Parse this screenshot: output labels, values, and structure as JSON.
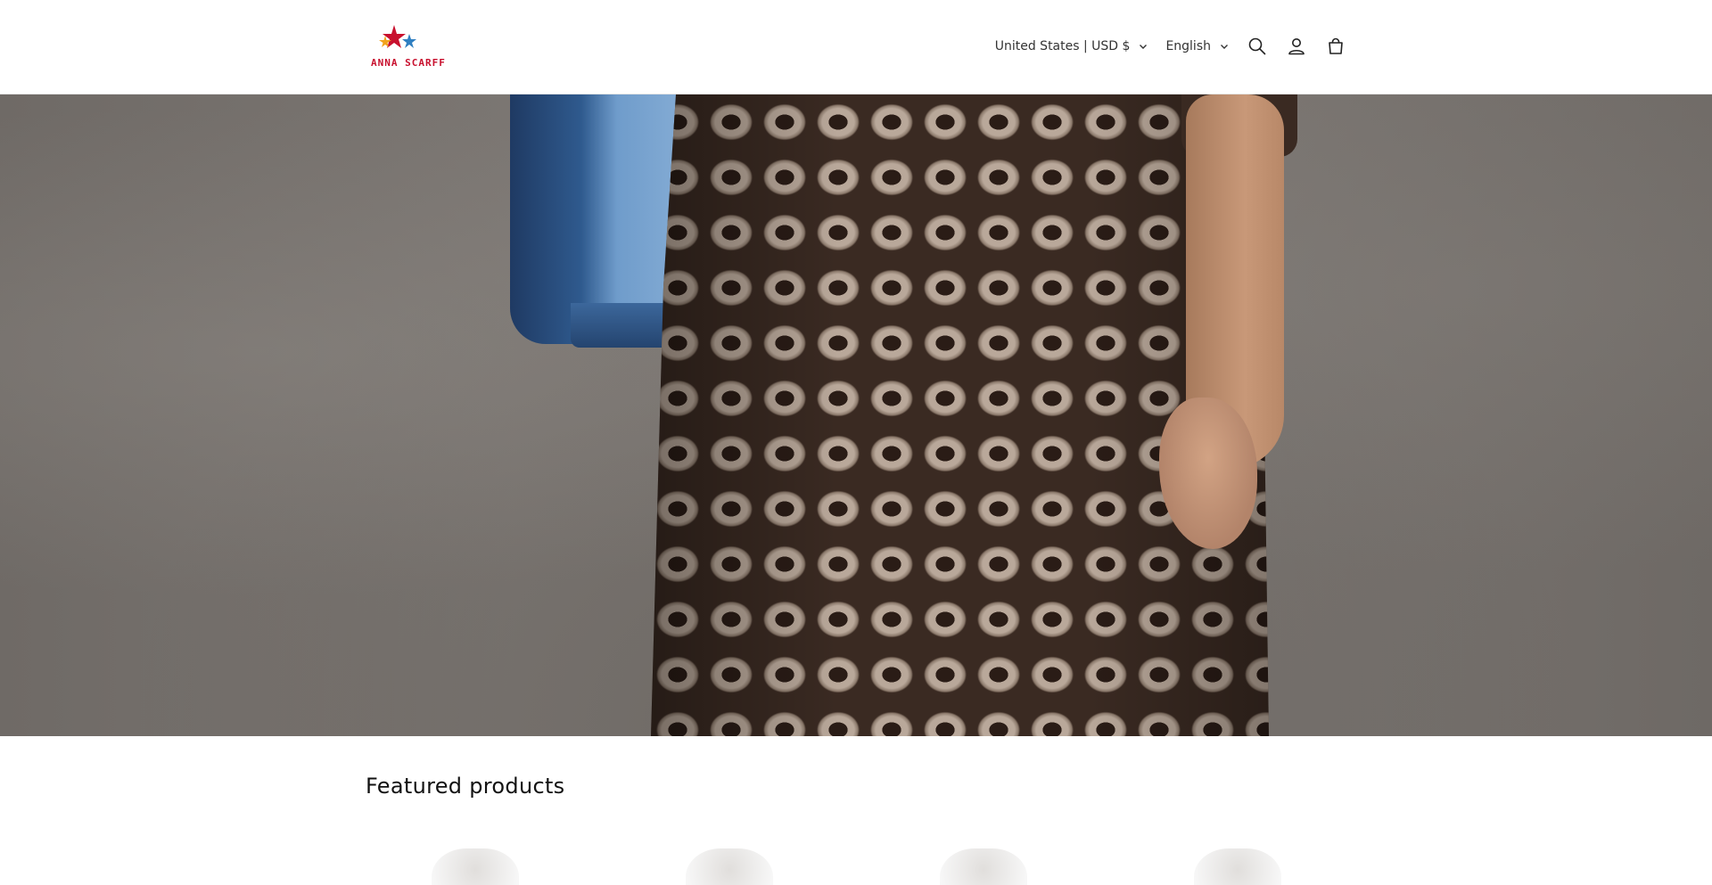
{
  "header": {
    "logo_text": "ANNA SCARFF",
    "localization": {
      "country_label": "United States | USD $",
      "language_label": "English"
    },
    "icons": [
      "search-icon",
      "account-icon",
      "cart-icon"
    ]
  },
  "hero": {
    "image_alt": ""
  },
  "featured": {
    "title": "Featured products",
    "products": [
      {
        "name": ""
      },
      {
        "name": ""
      },
      {
        "name": ""
      },
      {
        "name": ""
      }
    ]
  },
  "colors": {
    "logo_red": "#c8102e",
    "logo_blue": "#2f7fc1",
    "logo_orange": "#f2a31b",
    "text": "#121212"
  }
}
